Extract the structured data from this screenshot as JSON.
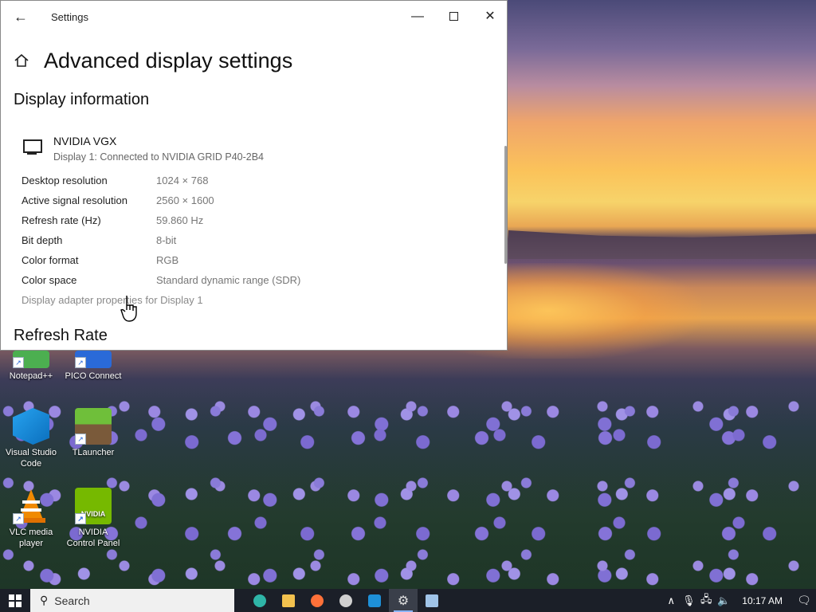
{
  "window": {
    "title": "Settings",
    "page_title": "Advanced display settings",
    "sections": {
      "display_information": "Display information",
      "refresh_rate": "Refresh Rate"
    },
    "adapter": {
      "name": "NVIDIA VGX",
      "description": "Display 1: Connected to NVIDIA GRID P40-2B4"
    },
    "info": [
      {
        "label": "Desktop resolution",
        "value": "1024 × 768"
      },
      {
        "label": "Active signal resolution",
        "value": "2560 × 1600"
      },
      {
        "label": "Refresh rate (Hz)",
        "value": "59.860 Hz"
      },
      {
        "label": "Bit depth",
        "value": "8-bit"
      },
      {
        "label": "Color format",
        "value": "RGB"
      },
      {
        "label": "Color space",
        "value": "Standard dynamic range (SDR)"
      }
    ],
    "adapter_link": "Display adapter properties for Display 1"
  },
  "desktop_icons": [
    {
      "label": "Notepad++",
      "icon": "notepadpp-icon",
      "color": "#4caf50"
    },
    {
      "label": "PICO Connect",
      "icon": "pico-connect-icon",
      "color": "#2a6ad8"
    },
    {
      "label": "Visual Studio Code",
      "icon": "vscode-icon",
      "color": "#1f8ad2"
    },
    {
      "label": "TLauncher",
      "icon": "tlauncher-icon",
      "color": "#5aa02c"
    },
    {
      "label": "VLC media player",
      "icon": "vlc-icon",
      "color": "#f08a00"
    },
    {
      "label": "NVIDIA Control Panel",
      "icon": "nvidia-icon",
      "color": "#76b900"
    }
  ],
  "taskbar": {
    "search_label": "Search",
    "apps": [
      {
        "name": "edge-icon",
        "color": "#2fb5a8"
      },
      {
        "name": "file-explorer-icon",
        "color": "#f2c14e"
      },
      {
        "name": "firefox-icon",
        "color": "#ff7139"
      },
      {
        "name": "chrome-icon",
        "color": "#d0d0d0"
      },
      {
        "name": "app-c-icon",
        "color": "#1e90d8"
      },
      {
        "name": "settings-icon",
        "color": "#e0e0e0"
      },
      {
        "name": "remote-desktop-icon",
        "color": "#a0c4e8"
      }
    ],
    "clock": "10:17 AM"
  }
}
